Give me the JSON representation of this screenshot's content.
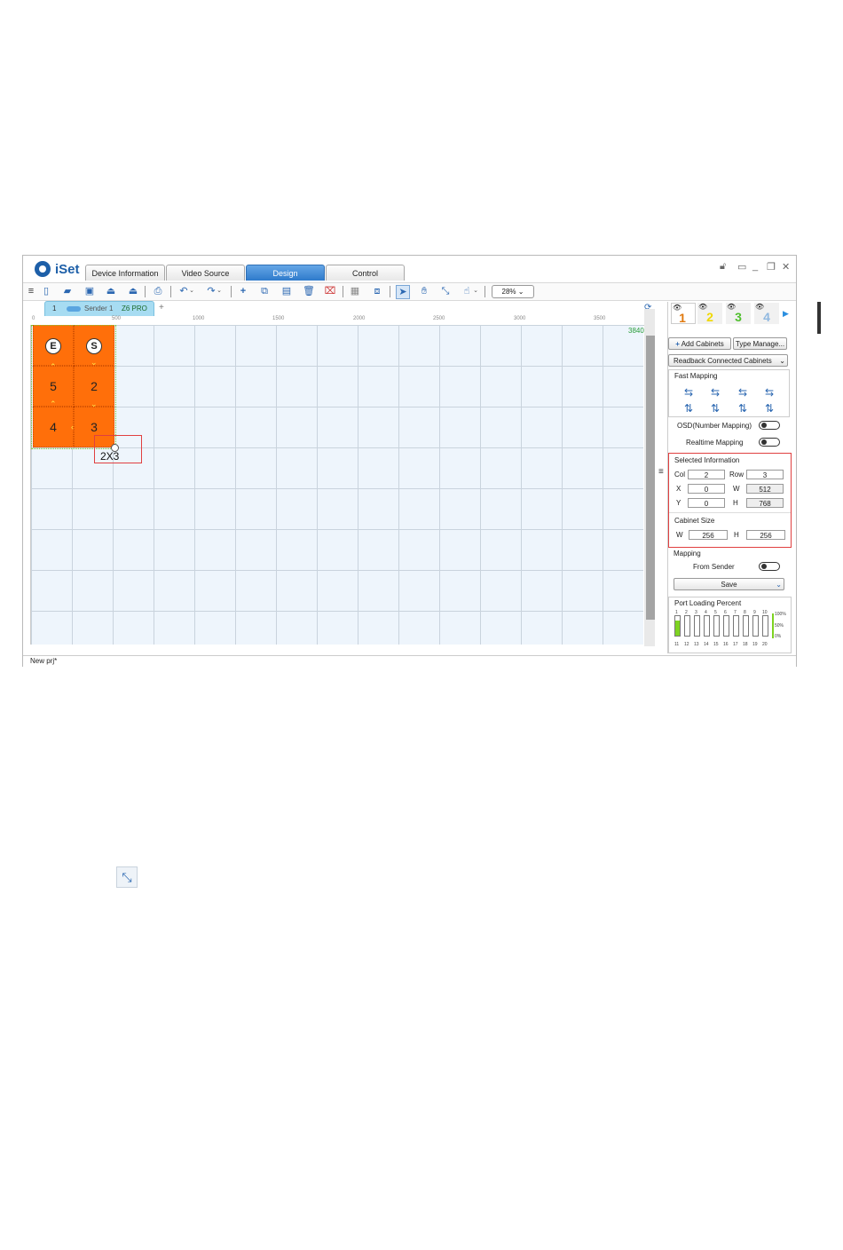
{
  "app": {
    "name": "iSet"
  },
  "tabs": [
    {
      "label": "Device Information",
      "active": false
    },
    {
      "label": "Video Source Settings",
      "active": false
    },
    {
      "label": "Design",
      "active": true
    },
    {
      "label": "Control",
      "active": false
    }
  ],
  "toolbar": {
    "zoom": "28%"
  },
  "sender_tab": {
    "index": "1",
    "name": "Sender 1",
    "model": "Z6 PRO",
    "add": "+"
  },
  "ruler": {
    "top_ticks": [
      "0",
      "500",
      "1000",
      "1500",
      "2000",
      "2500",
      "3000",
      "3500"
    ],
    "end_value": "3840"
  },
  "layout": {
    "grid": "2X3",
    "start_marker": "S",
    "end_marker": "E",
    "cabinet_numbers": {
      "r1c1": "5",
      "r1c2": "2",
      "r2c1": "4",
      "r2c2": "3"
    }
  },
  "status": {
    "project": "New prj*"
  },
  "panel": {
    "port_numbers": [
      "1",
      "2",
      "3",
      "4"
    ],
    "add_cabinets": "Add Cabinets",
    "type_manage": "Type Manage...",
    "readback": "Readback Connected Cabinets",
    "fast_mapping": "Fast Mapping",
    "osd_label": "OSD(Number Mapping)",
    "realtime_label": "Realtime Mapping",
    "selected_info": "Selected Information",
    "col_label": "Col",
    "col_value": "2",
    "row_label": "Row",
    "row_value": "3",
    "x_label": "X",
    "x_value": "0",
    "w_label": "W",
    "w_value": "512",
    "y_label": "Y",
    "y_value": "0",
    "h_label": "H",
    "h_value": "768",
    "cabinet_size": "Cabinet Size",
    "cw_label": "W",
    "cw_value": "256",
    "ch_label": "H",
    "ch_value": "256",
    "mapping": "Mapping",
    "from_sender": "From Sender",
    "save": "Save",
    "port_loading": "Port Loading Percent",
    "load_top": "100%",
    "load_mid": "50%",
    "load_bottom": "0%",
    "ports_row1": [
      "1",
      "2",
      "3",
      "4",
      "5",
      "6",
      "7",
      "8",
      "9",
      "10"
    ],
    "ports_row2": [
      "11",
      "12",
      "13",
      "14",
      "15",
      "16",
      "17",
      "18",
      "19",
      "20"
    ],
    "port1_load_fraction": 0.75
  }
}
